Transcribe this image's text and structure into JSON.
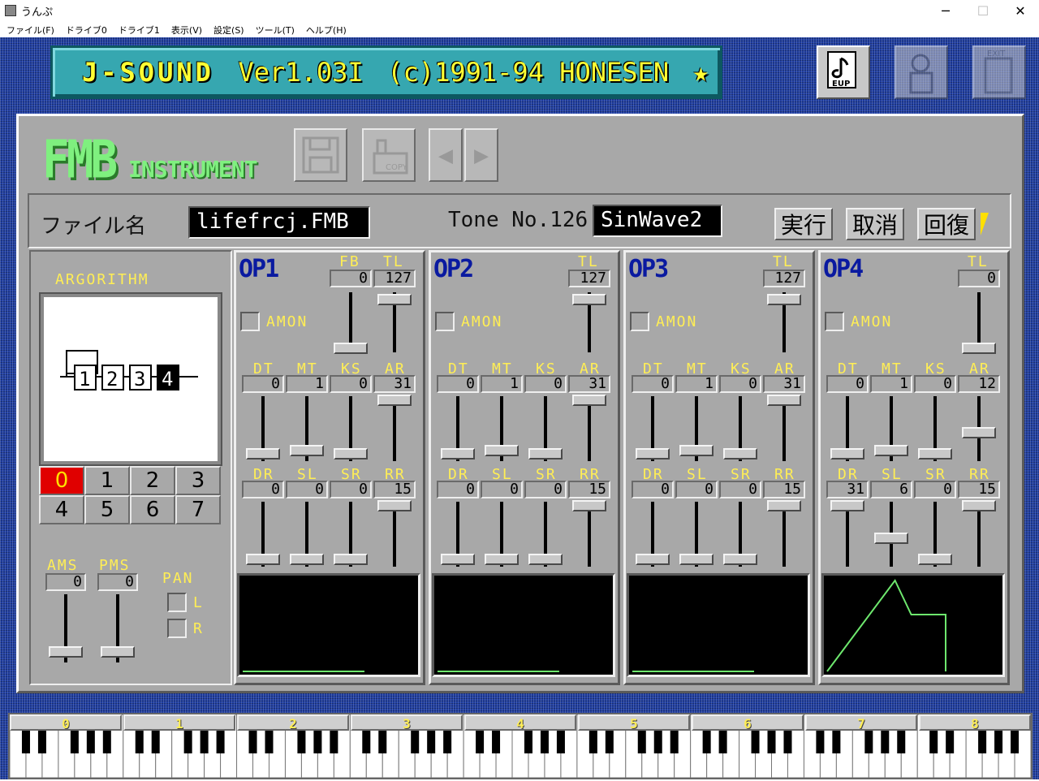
{
  "window": {
    "title": "うんぷ",
    "minimize": "─",
    "maximize": "☐",
    "close": "✕"
  },
  "menu": [
    "ファイル(F)",
    "ドライブ0",
    "ドライブ1",
    "表示(V)",
    "設定(S)",
    "ツール(T)",
    "ヘルプ(H)"
  ],
  "banner": {
    "main": "J-SOUND",
    "version": "Ver1.03I",
    "copyright": "(c)1991-94 HONESEN",
    "star": "★"
  },
  "top_icons": {
    "eup": "EUP",
    "exit": "EXIT"
  },
  "header": {
    "fmb": "FMB",
    "instrument": "INSTRUMENT",
    "copy": "COPY"
  },
  "file": {
    "label": "ファイル名",
    "filename": "lifefrcj.FMB",
    "tone_label": "Tone No.126",
    "tone_name": "SinWave2"
  },
  "commands": {
    "execute": "実行",
    "cancel": "取消",
    "restore": "回復"
  },
  "algorithm": {
    "label": "ARGORITHM",
    "ops": [
      "1",
      "2",
      "3",
      "4"
    ],
    "choices": [
      "0",
      "1",
      "2",
      "3",
      "4",
      "5",
      "6",
      "7"
    ],
    "selected": 0
  },
  "global": {
    "ams_label": "AMS",
    "ams": "0",
    "pms_label": "PMS",
    "pms": "0",
    "pan_label": "PAN",
    "pan_l": "L",
    "pan_r": "R"
  },
  "operators": [
    {
      "name": "OP1",
      "fb": "0",
      "tl": "127",
      "amon": "AMON",
      "dt": "0",
      "mt": "1",
      "ks": "0",
      "ar": "31",
      "dr": "0",
      "sl": "0",
      "sr": "0",
      "rr": "15"
    },
    {
      "name": "OP2",
      "fb": null,
      "tl": "127",
      "amon": "AMON",
      "dt": "0",
      "mt": "1",
      "ks": "0",
      "ar": "31",
      "dr": "0",
      "sl": "0",
      "sr": "0",
      "rr": "15"
    },
    {
      "name": "OP3",
      "fb": null,
      "tl": "127",
      "amon": "AMON",
      "dt": "0",
      "mt": "1",
      "ks": "0",
      "ar": "31",
      "dr": "0",
      "sl": "0",
      "sr": "0",
      "rr": "15"
    },
    {
      "name": "OP4",
      "fb": null,
      "tl": "0",
      "amon": "AMON",
      "dt": "0",
      "mt": "1",
      "ks": "0",
      "ar": "12",
      "dr": "31",
      "sl": "6",
      "sr": "0",
      "rr": "15"
    }
  ],
  "param_labels": {
    "fb": "FB",
    "tl": "TL",
    "dt": "DT",
    "mt": "MT",
    "ks": "KS",
    "ar": "AR",
    "dr": "DR",
    "sl": "SL",
    "sr": "SR",
    "rr": "RR"
  },
  "octaves": [
    "0",
    "1",
    "2",
    "3",
    "4",
    "5",
    "6",
    "7",
    "8"
  ]
}
